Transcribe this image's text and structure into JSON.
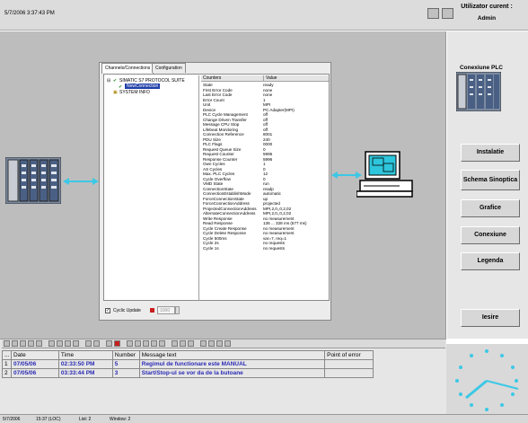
{
  "header": {
    "timestamp": "5/7/2006 3:37:43 PM",
    "user_label": "Utilizator curent :",
    "user_name": "Admin"
  },
  "nav": {
    "section_label": "Conexiune PLC",
    "buttons": [
      "Instalatie",
      "Schema Sinoptica",
      "Grafice",
      "Conexiune",
      "Legenda"
    ],
    "exit_label": "Iesire"
  },
  "dialog": {
    "tabs": [
      "Channels/Connections",
      "Configuration"
    ],
    "tree": {
      "root": "SIMATIC S7 PROTOCOL SUITE",
      "connection": "NewConnection",
      "info": "SYSTEM INFO"
    },
    "columns": [
      "Counters",
      "Value"
    ],
    "rows": [
      [
        "State",
        "ready"
      ],
      [
        "First Error Code",
        "none"
      ],
      [
        "Last Error Code",
        "none"
      ],
      [
        "Error Count",
        "1"
      ],
      [
        "Unit",
        "MPI"
      ],
      [
        "Device",
        "PC Adapter(MPI)"
      ],
      [
        "PLC Cycle Management",
        "off"
      ],
      [
        "Change Driven Transfer",
        "off"
      ],
      [
        "Message CPU Stop",
        "off"
      ],
      [
        "Lifebeat Monitoring",
        "off"
      ],
      [
        "Connection Reference",
        "8001"
      ],
      [
        "PDU Size",
        "240"
      ],
      [
        "PLC Flags",
        "0000"
      ],
      [
        "Request Queue Size",
        "0"
      ],
      [
        "Request Counter",
        "5995"
      ],
      [
        "Response Counter",
        "5996"
      ],
      [
        "Own Cycles",
        "1"
      ],
      [
        "AS Cycles",
        "0"
      ],
      [
        "Max. PLC Cycles",
        "12"
      ],
      [
        "Cycle Overflow",
        "0"
      ],
      [
        "VMD State",
        "run"
      ],
      [
        "ConnectionState",
        "readp"
      ],
      [
        "ConnectionEstablishMode",
        "automatic"
      ],
      [
        "ForceConnectionState",
        "up"
      ],
      [
        "ForceConnectionAddress",
        "projected"
      ],
      [
        "ProjectedConnectionAddress",
        "MPI,2,0,,0,2,02"
      ],
      [
        "AlternateConnectionAddress",
        "MPI,2,0,,0,2,02"
      ],
      [
        "Write Response",
        "no measurement"
      ],
      [
        "Read Response",
        "136 ... 328 ms (577 ms)"
      ],
      [
        "Cycle Create Response",
        "no measurement"
      ],
      [
        "Cycle Delete Response",
        "no measurement"
      ],
      [
        "Cycle 500ms",
        "var=7, req=1"
      ],
      [
        "Cycle 2s",
        "no requests"
      ],
      [
        "Cycle 1s",
        "no requests"
      ]
    ],
    "cyclic_update_label": "Cyclic Update",
    "cyclic_update_value": "1000"
  },
  "messages": {
    "columns": [
      "...",
      "Date",
      "Time",
      "Number",
      "Message text",
      "Point of error"
    ],
    "rows": [
      {
        "idx": "1",
        "date": "07/05/06",
        "time": "02:33:50 PM",
        "number": "5",
        "text": "Regimul de functionare este MANUAL",
        "point": ""
      },
      {
        "idx": "2",
        "date": "07/05/06",
        "time": "03:33:44 PM",
        "number": "3",
        "text": "Start/Stop-ul se vor da de la butoane",
        "point": ""
      }
    ]
  },
  "status": {
    "left": "5/7/2006",
    "time": "15:37 (LOC)",
    "list": "List: 2",
    "window": "Window: 2"
  },
  "colors": {
    "accent_blue": "#2a2ab4",
    "selection": "#1f3fa8",
    "cyan_link": "#3cc8e6"
  }
}
